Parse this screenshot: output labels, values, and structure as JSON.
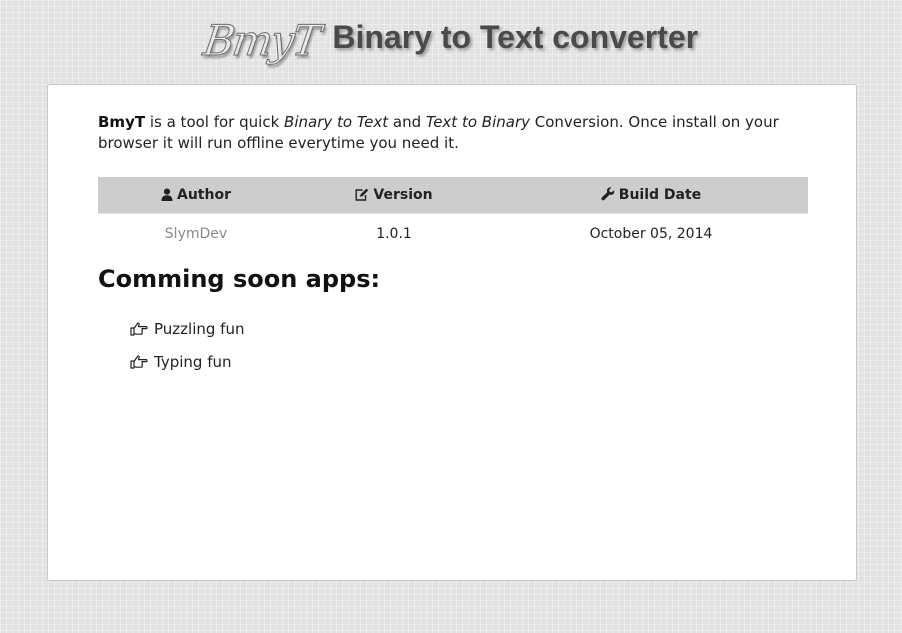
{
  "header": {
    "logo_text": "BmyT",
    "title": "Binary to Text converter"
  },
  "intro": {
    "brand": "BmyT",
    "part1": " is a tool for quick ",
    "em1": "Binary to Text",
    "part2": " and ",
    "em2": "Text to Binary",
    "part3": " Conversion. Once install on your browser it will run offline everytime you need it."
  },
  "info_table": {
    "headers": {
      "author": "Author",
      "version": "Version",
      "build_date": "Build Date"
    },
    "header_icons": {
      "author": "user-icon",
      "version": "edit-icon",
      "build_date": "wrench-icon"
    },
    "row": {
      "author": "SlymDev",
      "version": "1.0.1",
      "build_date": "October 05, 2014"
    }
  },
  "coming_soon": {
    "title": "Comming soon apps:",
    "items": [
      {
        "label": "Puzzling fun",
        "icon": "hand-pointing-right-icon"
      },
      {
        "label": "Typing fun",
        "icon": "hand-pointing-right-icon"
      }
    ]
  }
}
